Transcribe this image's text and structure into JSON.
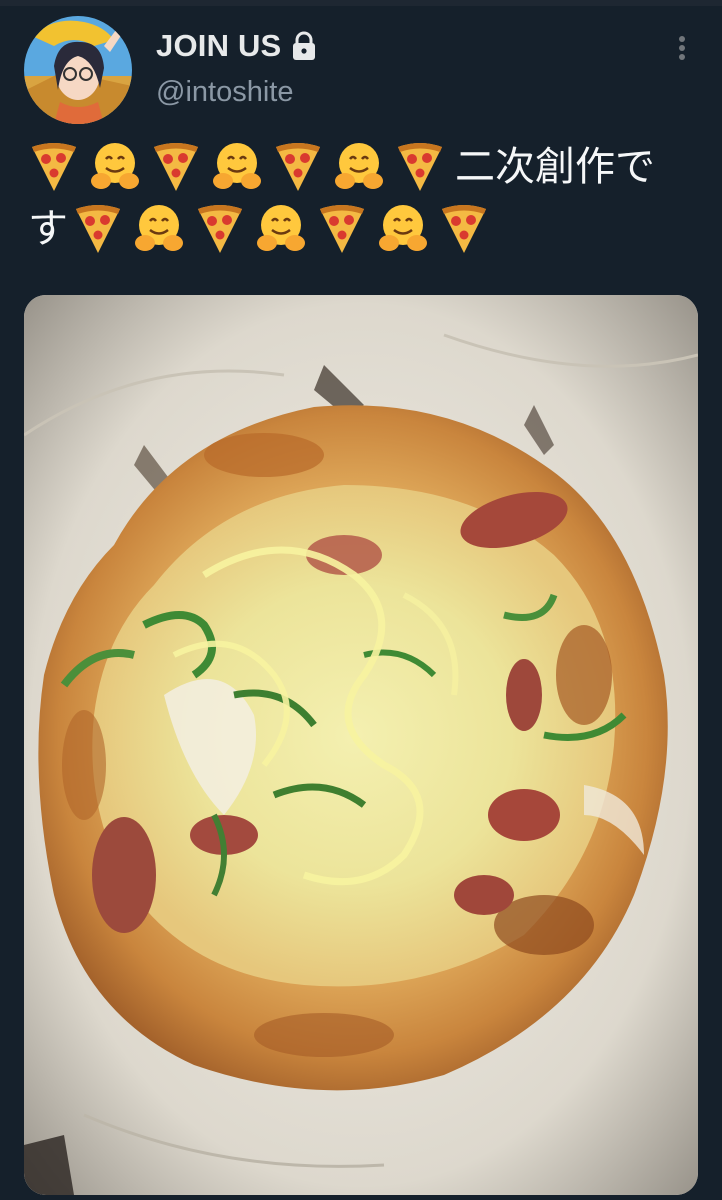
{
  "tweet": {
    "author": {
      "display_name": "JOIN US",
      "handle": "@intoshite",
      "protected": true,
      "avatar_icon": "anime-character-avatar-icon"
    },
    "text_parts": {
      "line1_text": "二次創作で",
      "line2_text": "す"
    },
    "emoji_names": [
      "pizza-icon",
      "hugging-face-icon"
    ],
    "more_icon": "more-dots-icon",
    "media": {
      "type": "photo",
      "subject": "homemade-pizza-photo"
    }
  },
  "colors": {
    "background": "#15202b",
    "name": "#e7e9ea",
    "handle": "#8b98a5"
  }
}
